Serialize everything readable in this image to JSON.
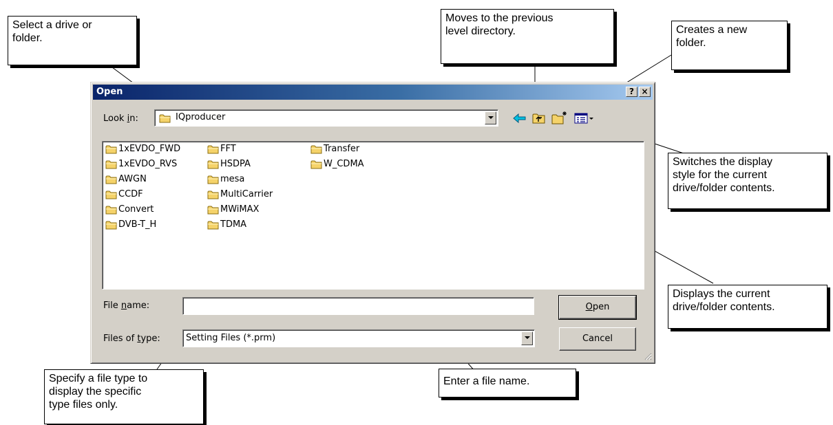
{
  "dialog": {
    "title": "Open",
    "help_label": "?",
    "close_label": "×",
    "look_in": {
      "label_before": "Look ",
      "label_key": "i",
      "label_after": "n:",
      "value": "IQproducer"
    },
    "files": [
      {
        "name": "1xEVDO_FWD"
      },
      {
        "name": "1xEVDO_RVS"
      },
      {
        "name": "AWGN"
      },
      {
        "name": "CCDF"
      },
      {
        "name": "Convert"
      },
      {
        "name": "DVB-T_H"
      },
      {
        "name": "FFT"
      },
      {
        "name": "HSDPA"
      },
      {
        "name": "mesa"
      },
      {
        "name": "MultiCarrier"
      },
      {
        "name": "MWiMAX"
      },
      {
        "name": "TDMA"
      },
      {
        "name": "Transfer"
      },
      {
        "name": "W_CDMA"
      }
    ],
    "file_name": {
      "label_before": "File ",
      "label_key": "n",
      "label_after": "ame:",
      "value": ""
    },
    "files_of_type": {
      "label_before": "Files of ",
      "label_key": "t",
      "label_after": "ype:",
      "value": "Setting Files (*.prm)"
    },
    "open_button": {
      "key": "O",
      "rest": "pen"
    },
    "cancel_button": "Cancel",
    "toolbar_icons": [
      "back-arrow-icon",
      "up-one-level-icon",
      "new-folder-icon",
      "view-menu-icon"
    ]
  },
  "callouts": {
    "select_drive": [
      "Select a drive or",
      "folder."
    ],
    "up_level": [
      "Moves to the previous",
      "level directory."
    ],
    "new_folder": [
      "Creates a new",
      "folder."
    ],
    "view_style": [
      "Switches the display",
      "style for the current",
      "drive/folder contents."
    ],
    "contents": [
      "Displays the current",
      "drive/folder contents."
    ],
    "file_name": [
      "Enter a file name."
    ],
    "file_type": [
      "Specify a file type to",
      "display the specific",
      "type files only."
    ]
  },
  "colors": {
    "titlebar_start": "#0a246a",
    "titlebar_end": "#a6caf0",
    "dialog_face": "#d4d0c8",
    "folder": "#f5d36a"
  }
}
